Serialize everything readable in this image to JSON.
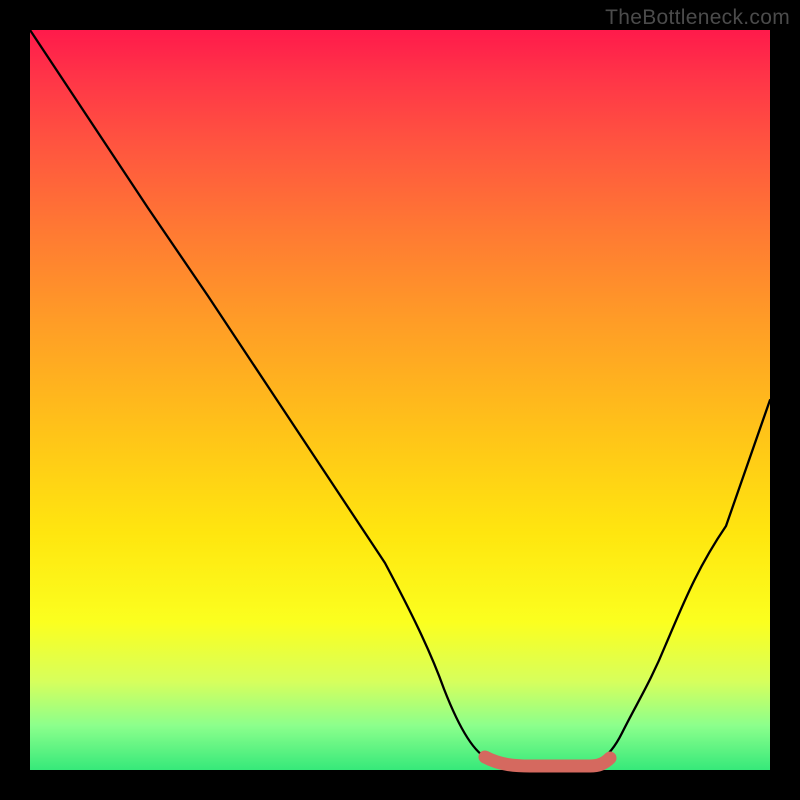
{
  "watermark": "TheBottleneck.com",
  "chart_data": {
    "type": "line",
    "title": "",
    "xlabel": "",
    "ylabel": "",
    "xlim": [
      0,
      100
    ],
    "ylim": [
      0,
      100
    ],
    "grid": false,
    "series": [
      {
        "name": "curve",
        "x": [
          0,
          8,
          16,
          24,
          32,
          40,
          48,
          54,
          58,
          62,
          66,
          70,
          74,
          78,
          82,
          86,
          90,
          94,
          100
        ],
        "y": [
          100,
          88,
          76,
          64,
          52,
          40,
          28,
          18,
          10,
          4,
          1,
          0.5,
          0.5,
          1,
          5,
          12,
          22,
          33,
          50
        ]
      }
    ],
    "highlight_segment": {
      "x_start": 62,
      "x_end": 78,
      "note": "flat-bottom (optimal zone) in salmon"
    },
    "background_gradient": [
      "#ff1a4b",
      "#ffe60f",
      "#36e97a"
    ]
  }
}
